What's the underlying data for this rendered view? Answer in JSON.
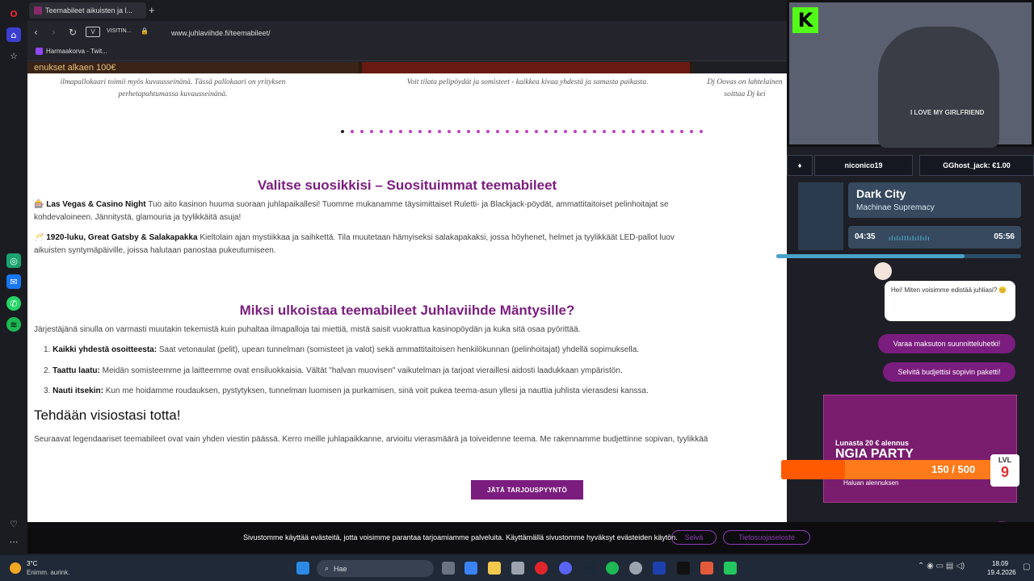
{
  "browser": {
    "tab_title": "Teemabileet aikuisten ja l...",
    "new_tab": "+",
    "back": "‹",
    "forward": "›",
    "reload": "↻",
    "vpn": "V",
    "visiting": "VISITIN...",
    "lock": "🔒",
    "url": "www.juhlaviihde.fi/teemabileet/",
    "bookmark": "Harmaakorva - Twit..."
  },
  "page": {
    "hero_text": "enukset alkaen 100€",
    "captions": [
      "ilmapallokaari toimii myös kuvausseinänä. Tässä pallokaari on yrityksen perhetapahtumassa kuvausseinänä.",
      "Voit tilata pelipöydät ja somisteet - kaikkea kivaa yhdestä ja samasta paikasta.",
      "Dj Oovas on lahtelainen soittaa Dj kei"
    ],
    "section1_title": "Valitse suosikkisi – Suosituimmat teemabileet",
    "item1_icon": "🎰",
    "item1_title": "Las Vegas & Casino Night",
    "item1_text": "Tuo aito kasinon huuma suoraan juhlapaikallesi! Tuomme mukanamme täysimittaiset Ruletti- ja Blackjack-pöydät, ammattitaitoiset pelinhoitajat se",
    "item1_text2": "kohdevaloineen. Jännitystä, glamouria ja tyylikkäitä asuja!",
    "item2_icon": "🥂",
    "item2_title": "1920-luku, Great Gatsby & Salakapakka",
    "item2_text": "Kieltolain ajan mystiikkaa ja saihkettä. Tila muutetaan hämyiseksi salakapakaksi, jossa höyhenet, helmet ja tyylikkäät LED-pallot luov",
    "item2_text2": "aikuisten syntymäpäiville, joissa halutaan panostaa pukeutumiseen.",
    "section2_title": "Miksi ulkoistaa teemabileet Juhlaviihde Mäntysille?",
    "intro": "Järjestäjänä sinulla on varmasti muutakin tekemistä kuin puhaltaa ilmapalloja tai miettiä, mistä saisit vuokrattua kasinopöydän ja kuka sitä osaa pyörittää.",
    "list": [
      {
        "num": "1.",
        "title": "Kaikki yhdestä osoitteesta:",
        "text": "Saat vetonaulat (pelit), upean tunnelman (somisteet ja valot) sekä ammattitaitoisen henkilökunnan (pelinhoitajat) yhdellä sopimuksella."
      },
      {
        "num": "2.",
        "title": "Taattu laatu:",
        "text": "Meidän somisteemme ja laitteemme ovat ensiluokkaisia. Vältät \"halvan muovisen\" vaikutelman ja tarjoat vieraillesi aidosti laadukkaan ympäristön."
      },
      {
        "num": "3.",
        "title": "Nauti itsekin:",
        "text": "Kun me hoidamme roudauksen, pystytyksen, tunnelman luomisen ja purkamisen, sinä voit pukea teema-asun yllesi ja nauttia juhlista vierasdesi kanssa."
      }
    ],
    "heading3": "Tehdään visiostasi totta!",
    "closing": "Seuraavat legendaariset teemabileet ovat vain yhden viestin päässä. Kerro meille juhlapaikkanne, arvioitu vierasmäärä ja toiveidenne teema. Me rakennamme budjettinne sopivan, tyylikkää",
    "cta": "JÄTÄ TARJOUSPYYNTÖ"
  },
  "cookie": {
    "text": "Sivustomme käyttää evästeitä, jotta voisimme parantaa tarjoamiamme palveluita. Käyttämällä sivustomme hyväksyt evästeiden käytön.",
    "accept": "Selvä",
    "policy": "Tietosuojaseloste"
  },
  "stream": {
    "kick_logo": "K",
    "shirt_text": "I LOVE MY GIRLFRIEND",
    "alert1": "niconico19",
    "alert2": "GGhost_jack: €1.00",
    "song_title": "Dark City",
    "song_artist": "Machinae Supremacy",
    "time_elapsed": "04:35",
    "time_total": "05:56",
    "progress": 0.77,
    "xp_text": "150 / 500",
    "xp_progress": 0.3,
    "lvl_label": "LVL",
    "lvl_value": "9",
    "promo_line1": "Lunasta 20 € alennus",
    "promo_line2": "NGIA PARTY",
    "promo_button": "Haluan alennuksen"
  },
  "chat": {
    "bubble": "Hei! Miten voisimme edistää juhliasi? 😊",
    "chip1": "Varaa maksuton suunnitteluhetki!",
    "chip2": "Selvitä budjettisi sopivin paketti!"
  },
  "taskbar": {
    "temp": "3°C",
    "weather": "Enimm. aurink.",
    "search": "Hae",
    "time": "18.09",
    "date": "19.4.2026"
  },
  "colors": {
    "brand_purple": "#7b1d7f",
    "kick_green": "#53fc18",
    "xp_orange": "#ff7a1a"
  }
}
